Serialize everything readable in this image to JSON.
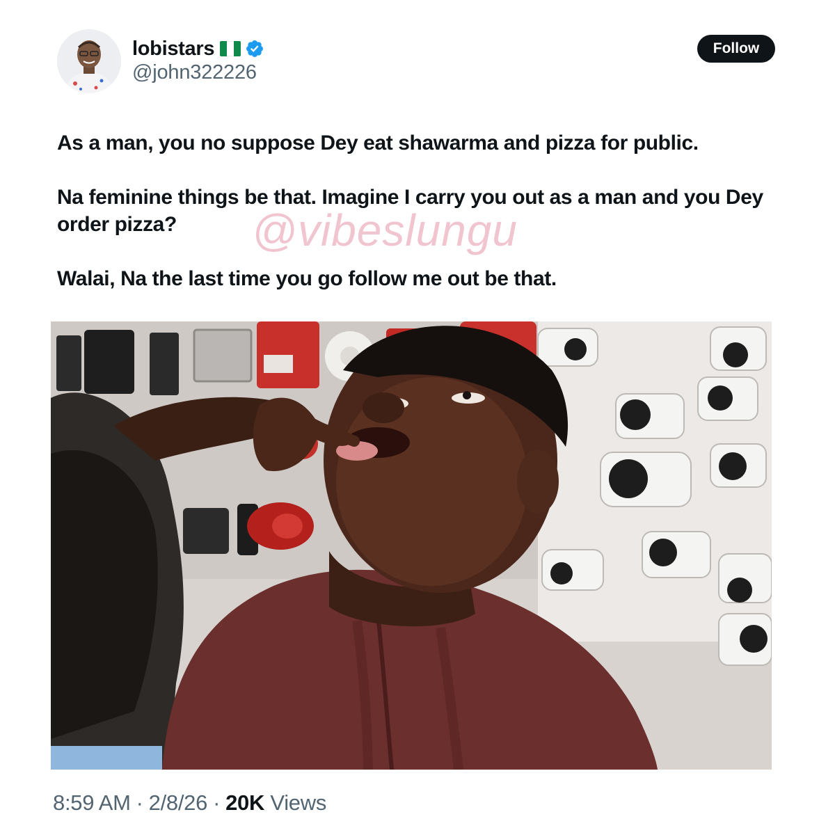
{
  "user": {
    "name": "lobistars",
    "flag_icon": "nigeria-flag-icon",
    "verified_icon": "verified-badge-icon",
    "handle": "@john322226"
  },
  "follow_label": "Follow",
  "tweet": {
    "paragraphs": [
      "As a man, you no suppose Dey eat shawarma and pizza for public.",
      "Na feminine things be that. Imagine I carry you out as a man and you Dey order pizza?",
      "Walai, Na the last time you go follow me out be that."
    ]
  },
  "watermark": "@vibeslungu",
  "meta": {
    "time": "8:59 AM",
    "separator": "·",
    "date": "2/8/26",
    "views_count": "20K",
    "views_label": "Views"
  },
  "colors": {
    "text_primary": "#0f1419",
    "text_secondary": "#536471",
    "follow_bg": "#0f1419",
    "verified_blue": "#1d9bf0"
  }
}
